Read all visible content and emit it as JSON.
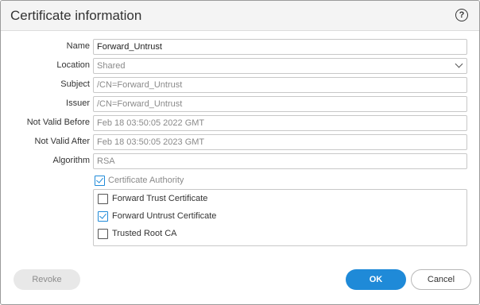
{
  "dialog": {
    "title": "Certificate information",
    "help_icon": "help-icon"
  },
  "fields": {
    "name": {
      "label": "Name",
      "value": "Forward_Untrust"
    },
    "location": {
      "label": "Location",
      "value": "Shared"
    },
    "subject": {
      "label": "Subject",
      "value": "/CN=Forward_Untrust"
    },
    "issuer": {
      "label": "Issuer",
      "value": "/CN=Forward_Untrust"
    },
    "not_valid_before": {
      "label": "Not Valid Before",
      "value": "Feb 18 03:50:05 2022 GMT"
    },
    "not_valid_after": {
      "label": "Not Valid After",
      "value": "Feb 18 03:50:05 2023 GMT"
    },
    "algorithm": {
      "label": "Algorithm",
      "value": "RSA"
    }
  },
  "certificate_authority": {
    "label": "Certificate Authority",
    "checked": true
  },
  "options": [
    {
      "label": "Forward Trust Certificate",
      "checked": false
    },
    {
      "label": "Forward Untrust Certificate",
      "checked": true
    },
    {
      "label": "Trusted Root CA",
      "checked": false
    }
  ],
  "buttons": {
    "revoke": "Revoke",
    "ok": "OK",
    "cancel": "Cancel"
  },
  "colors": {
    "accent": "#1f8ad8",
    "disabled_text": "#8a8a8a"
  }
}
